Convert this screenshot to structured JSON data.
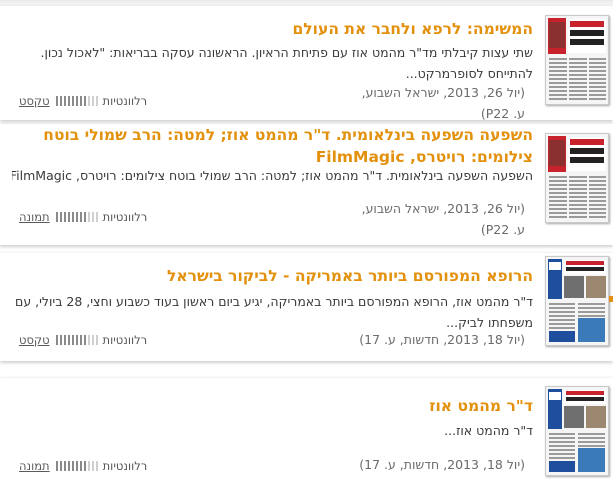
{
  "results": [
    {
      "title": "המשימה: לרפא ולחבר את העולם",
      "summary": "שתי עצות קיבלתי מד\"ר מהמט אוז עם פתיחת הראיון. הראשונה עסקה בבריאות: \"לאכול נכון. להתייחס לסופרמרקט...",
      "meta_line1": "(יול 26, 2013, ישראל השבוע,",
      "meta_line2": "ע. P22)",
      "type_label": "טקסט",
      "relevance_label": "רלוונטיות",
      "relevance_level": 0.72,
      "thumb_headline": "המשימה: לרפא ולחבר את העולם"
    },
    {
      "title": "השפעה השפעה בינלאומית. ד\"ר מהמט אוז; למטה: הרב שמולי בוטח צילומים: רויטרס, FilmMagic",
      "summary": "השפעה השפעה בינלאומית. ד\"ר מהמט אוז; למטה: הרב שמולי בוטח צילומים: רויטרס, FilmMagic...",
      "meta_line1": "(יול 26, 2013, ישראל השבוע,",
      "meta_line2": "ע. P22)",
      "type_label": "תמונה",
      "relevance_label": "רלוונטיות",
      "relevance_level": 0.72,
      "thumb_headline": "המשימה: לרפא ולחבר את העולם"
    },
    {
      "title": "הרופא המפורסם ביותר באמריקה - לביקור בישראל",
      "summary": "ד\"ר מהמט אוז, הרופא המפורסם ביותר באמריקה, יגיע ביום ראשון בעוד כשבוע וחצי, 28 ביולי, עם משפחתו לביק...",
      "meta_line1": "(יול 18, 2013, חדשות, ע. 17)",
      "meta_line2": "",
      "type_label": "טקסט",
      "relevance_label": "רלוונטיות",
      "relevance_level": 0.72,
      "thumb_headline": "הרופא המפורסם ביותר באמריקה - לביקור בישראל"
    },
    {
      "title": "ד\"ר מהמט אוז",
      "summary": "ד\"ר מהמט אוז...",
      "meta_line1": "(יול 18, 2013, חדשות, ע. 17)",
      "meta_line2": "",
      "type_label": "תמונה",
      "relevance_label": "רלוונטיות",
      "relevance_level": 0.72,
      "thumb_headline": "הרופא המפורסם ביותר באמריקה - לביקור בישראל"
    }
  ],
  "colors": {
    "title": "#e3910d",
    "summary": "#3a3a3a",
    "meta": "#6b6b6b",
    "bar_on": "#8a8a8a",
    "bar_off": "#cfcfcf",
    "thumb_red": "#c8232c",
    "thumb_blue": "#1f4e9c"
  }
}
